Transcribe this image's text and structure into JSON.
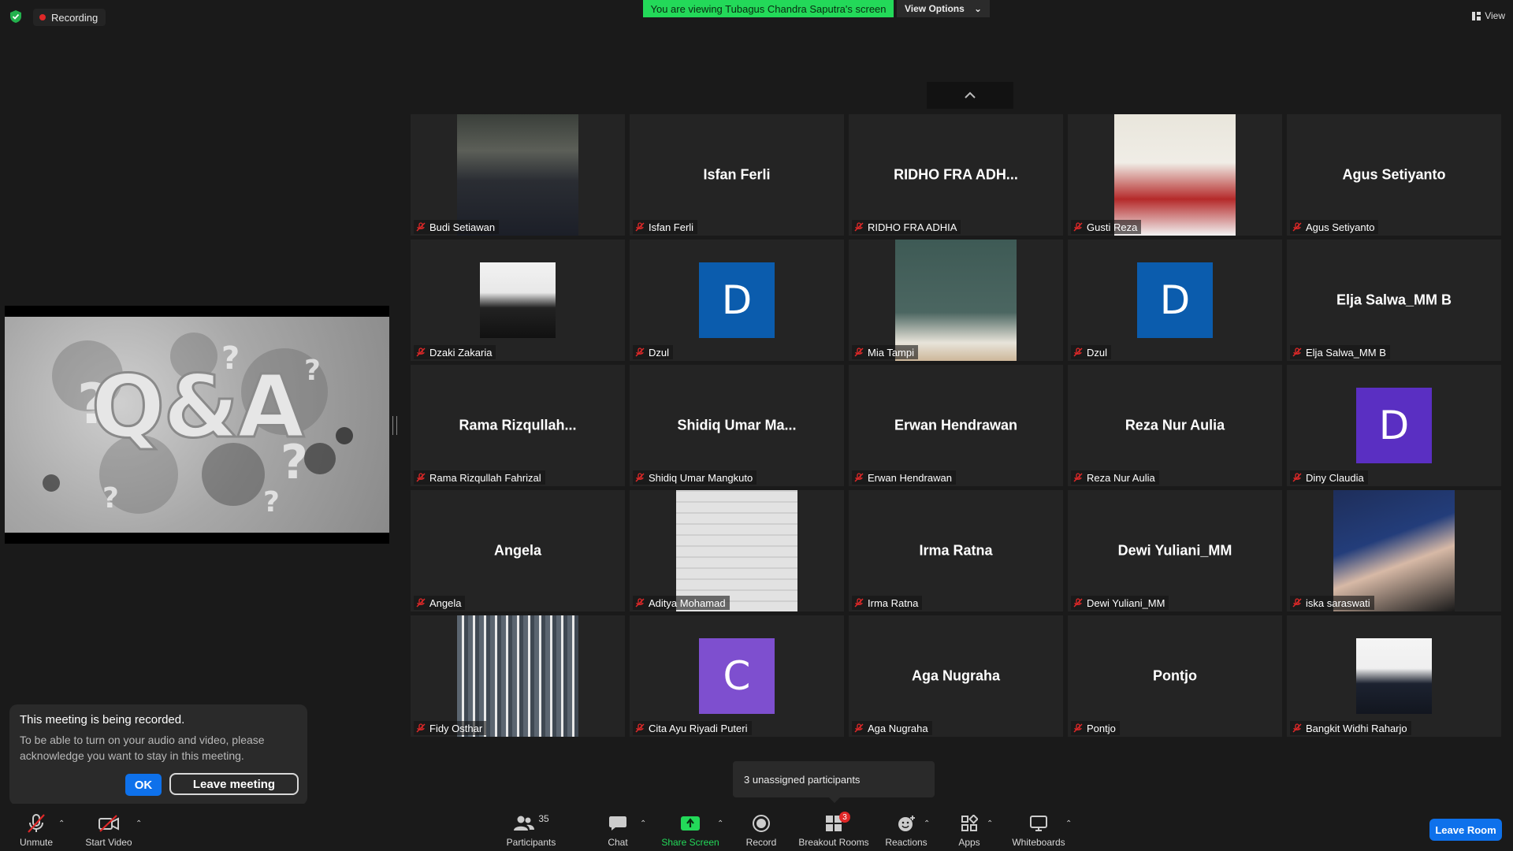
{
  "topbar": {
    "recording_label": "Recording",
    "viewing_banner": "You are viewing Tubagus Chandra Saputra's screen",
    "view_options": "View Options",
    "view": "View"
  },
  "shared_screen": {
    "text": "Q&A"
  },
  "tiles": [
    {
      "label": "Budi Setiawan",
      "display": "photo",
      "muted": true
    },
    {
      "label": "Isfan Ferli",
      "display": "name",
      "big": "Isfan Ferli",
      "muted": true
    },
    {
      "label": "RIDHO FRA ADHIA",
      "display": "name",
      "big": "RIDHO  FRA  ADH...",
      "muted": true
    },
    {
      "label": "Gusti Reza",
      "display": "photo",
      "muted": true
    },
    {
      "label": "Agus Setiyanto",
      "display": "name",
      "big": "Agus Setiyanto",
      "muted": true
    },
    {
      "label": "Dzaki Zakaria",
      "display": "photo-small",
      "muted": true
    },
    {
      "label": "Dzul",
      "display": "avatar",
      "letter": "D",
      "color": "#0b5cad",
      "muted": true
    },
    {
      "label": "Mia Tampi",
      "display": "photo",
      "muted": true
    },
    {
      "label": "Dzul",
      "display": "avatar",
      "letter": "D",
      "color": "#0b5cad",
      "muted": true
    },
    {
      "label": "Elja Salwa_MM B",
      "display": "name",
      "big": "Elja Salwa_MM B",
      "muted": true
    },
    {
      "label": "Rama Rizqullah Fahrizal",
      "display": "name",
      "big": "Rama  Rizqullah...",
      "muted": true
    },
    {
      "label": "Shidiq Umar Mangkuto",
      "display": "name",
      "big": "Shidiq  Umar  Ma...",
      "muted": true
    },
    {
      "label": "Erwan Hendrawan",
      "display": "name",
      "big": "Erwan Hendrawan",
      "muted": true
    },
    {
      "label": "Reza Nur Aulia",
      "display": "name",
      "big": "Reza Nur Aulia",
      "muted": true
    },
    {
      "label": "Diny Claudia",
      "display": "avatar",
      "letter": "D",
      "color": "#5a2fc2",
      "muted": true
    },
    {
      "label": "Angela",
      "display": "name",
      "big": "Angela",
      "muted": true
    },
    {
      "label": "Aditya Mohamad",
      "display": "photo",
      "muted": true
    },
    {
      "label": "Irma Ratna",
      "display": "name",
      "big": "Irma Ratna",
      "muted": true
    },
    {
      "label": "Dewi Yuliani_MM",
      "display": "name",
      "big": "Dewi Yuliani_MM",
      "muted": true
    },
    {
      "label": "iska saraswati",
      "display": "photo",
      "muted": true
    },
    {
      "label": "Fidy Osthar",
      "display": "photo",
      "muted": true
    },
    {
      "label": "Cita Ayu Riyadi Puteri",
      "display": "avatar",
      "letter": "C",
      "color": "#7e4fcf",
      "muted": true
    },
    {
      "label": "Aga Nugraha",
      "display": "name",
      "big": "Aga Nugraha",
      "muted": true
    },
    {
      "label": "Pontjo",
      "display": "name",
      "big": "Pontjo",
      "muted": true
    },
    {
      "label": "Bangkit Widhi Raharjo",
      "display": "photo-small",
      "muted": true
    }
  ],
  "notice": {
    "title": "This meeting is being recorded.",
    "body": "To be able to turn on your audio and video, please acknowledge you want to stay in this meeting.",
    "ok": "OK",
    "leave": "Leave meeting"
  },
  "unassigned": "3 unassigned participants",
  "toolbar": {
    "unmute": "Unmute",
    "start_video": "Start Video",
    "participants": "Participants",
    "participants_count": "35",
    "chat": "Chat",
    "share_screen": "Share Screen",
    "record": "Record",
    "breakout_rooms": "Breakout Rooms",
    "breakout_badge": "3",
    "reactions": "Reactions",
    "apps": "Apps",
    "whiteboards": "Whiteboards",
    "leave_room": "Leave Room"
  },
  "colors": {
    "share_green": "#23d959",
    "accent_blue": "#0e71eb",
    "mute_red": "#e02828"
  }
}
